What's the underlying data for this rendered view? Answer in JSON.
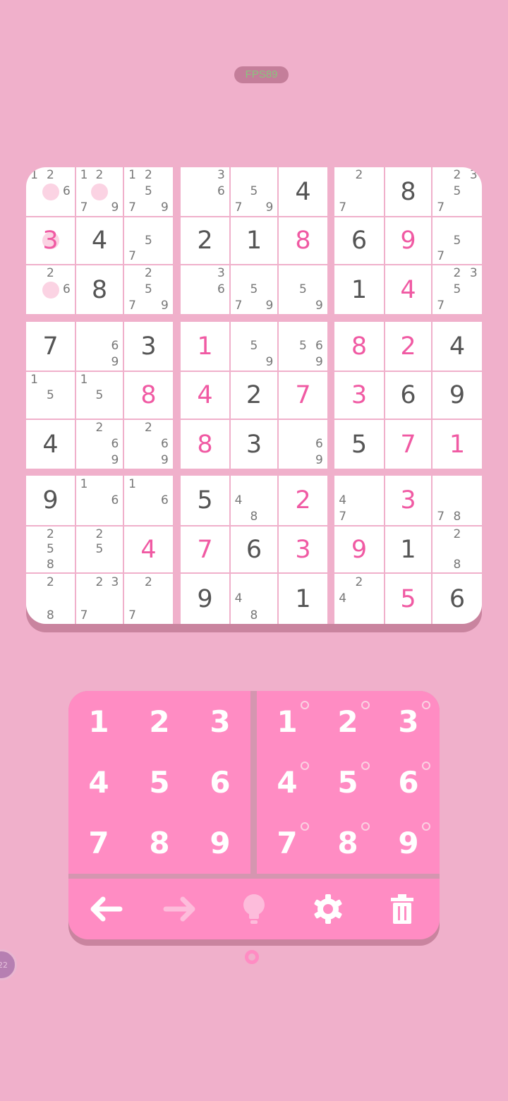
{
  "status": {
    "fps_label": "FPS89"
  },
  "board": {
    "rows": [
      [
        {
          "n": [
            1,
            2,
            6
          ]
        },
        {
          "n": [
            1,
            2,
            7,
            9
          ]
        },
        {
          "n": [
            1,
            2,
            5,
            7,
            9
          ]
        },
        {
          "n": [
            3,
            6
          ]
        },
        {
          "n": [
            5,
            7,
            9
          ]
        },
        {
          "v": 4,
          "t": "g"
        },
        {
          "n": [
            2,
            7
          ]
        },
        {
          "v": 8,
          "t": "g"
        },
        {
          "n": [
            2,
            3,
            5,
            7
          ]
        }
      ],
      [
        {
          "v": 3,
          "t": "u"
        },
        {
          "v": 4,
          "t": "g"
        },
        {
          "n": [
            5,
            7
          ]
        },
        {
          "v": 2,
          "t": "g"
        },
        {
          "v": 1,
          "t": "g"
        },
        {
          "v": 8,
          "t": "u"
        },
        {
          "v": 6,
          "t": "g"
        },
        {
          "v": 9,
          "t": "u"
        },
        {
          "n": [
            5,
            7
          ]
        }
      ],
      [
        {
          "n": [
            2,
            6
          ]
        },
        {
          "v": 8,
          "t": "g"
        },
        {
          "n": [
            2,
            5,
            7,
            9
          ]
        },
        {
          "n": [
            3,
            6
          ]
        },
        {
          "n": [
            5,
            7,
            9
          ]
        },
        {
          "n": [
            5,
            9
          ]
        },
        {
          "v": 1,
          "t": "g"
        },
        {
          "v": 4,
          "t": "u"
        },
        {
          "n": [
            2,
            3,
            5,
            7
          ]
        }
      ],
      [
        {
          "v": 7,
          "t": "g"
        },
        {
          "n": [
            6,
            9
          ]
        },
        {
          "v": 3,
          "t": "g"
        },
        {
          "v": 1,
          "t": "u"
        },
        {
          "n": [
            5,
            9
          ]
        },
        {
          "n": [
            5,
            6,
            9
          ]
        },
        {
          "v": 8,
          "t": "u"
        },
        {
          "v": 2,
          "t": "u"
        },
        {
          "v": 4,
          "t": "g"
        }
      ],
      [
        {
          "n": [
            1,
            5
          ]
        },
        {
          "n": [
            1,
            5
          ]
        },
        {
          "v": 8,
          "t": "u"
        },
        {
          "v": 4,
          "t": "u"
        },
        {
          "v": 2,
          "t": "g"
        },
        {
          "v": 7,
          "t": "u"
        },
        {
          "v": 3,
          "t": "u"
        },
        {
          "v": 6,
          "t": "g"
        },
        {
          "v": 9,
          "t": "g"
        }
      ],
      [
        {
          "v": 4,
          "t": "g"
        },
        {
          "n": [
            2,
            6,
            9
          ]
        },
        {
          "n": [
            2,
            6,
            9
          ]
        },
        {
          "v": 8,
          "t": "u"
        },
        {
          "v": 3,
          "t": "g"
        },
        {
          "n": [
            6,
            9
          ]
        },
        {
          "v": 5,
          "t": "g"
        },
        {
          "v": 7,
          "t": "u"
        },
        {
          "v": 1,
          "t": "u"
        }
      ],
      [
        {
          "v": 9,
          "t": "g"
        },
        {
          "n": [
            1,
            6
          ]
        },
        {
          "n": [
            1,
            6
          ]
        },
        {
          "v": 5,
          "t": "g"
        },
        {
          "n": [
            4,
            8
          ]
        },
        {
          "v": 2,
          "t": "u"
        },
        {
          "n": [
            4,
            7
          ]
        },
        {
          "v": 3,
          "t": "u"
        },
        {
          "n": [
            7,
            8
          ]
        }
      ],
      [
        {
          "n": [
            2,
            5,
            8
          ]
        },
        {
          "n": [
            2,
            5
          ]
        },
        {
          "v": 4,
          "t": "u"
        },
        {
          "v": 7,
          "t": "u"
        },
        {
          "v": 6,
          "t": "g"
        },
        {
          "v": 3,
          "t": "u"
        },
        {
          "v": 9,
          "t": "u"
        },
        {
          "v": 1,
          "t": "g"
        },
        {
          "n": [
            2,
            8
          ]
        }
      ],
      [
        {
          "n": [
            2,
            8
          ]
        },
        {
          "n": [
            2,
            3,
            7
          ]
        },
        {
          "n": [
            2,
            7
          ]
        },
        {
          "v": 9,
          "t": "g"
        },
        {
          "n": [
            4,
            8
          ]
        },
        {
          "v": 1,
          "t": "g"
        },
        {
          "n": [
            2,
            4
          ]
        },
        {
          "v": 5,
          "t": "u"
        },
        {
          "v": 6,
          "t": "g"
        }
      ]
    ]
  },
  "keypad": {
    "numbers": [
      "1",
      "2",
      "3",
      "4",
      "5",
      "6",
      "7",
      "8",
      "9"
    ],
    "pencil_numbers": [
      "1",
      "2",
      "3",
      "4",
      "5",
      "6",
      "7",
      "8",
      "9"
    ]
  },
  "toolbar": {
    "icons": [
      "arrow-left-icon",
      "arrow-right-icon",
      "lightbulb-icon",
      "gear-icon",
      "trash-icon"
    ]
  },
  "floating": {
    "bubble_text": "22"
  },
  "colors": {
    "background": "#f0b0cb",
    "accent": "#ff8cc3",
    "user_digit": "#f05aa3",
    "given_digit": "#555555",
    "note": "#777777"
  }
}
